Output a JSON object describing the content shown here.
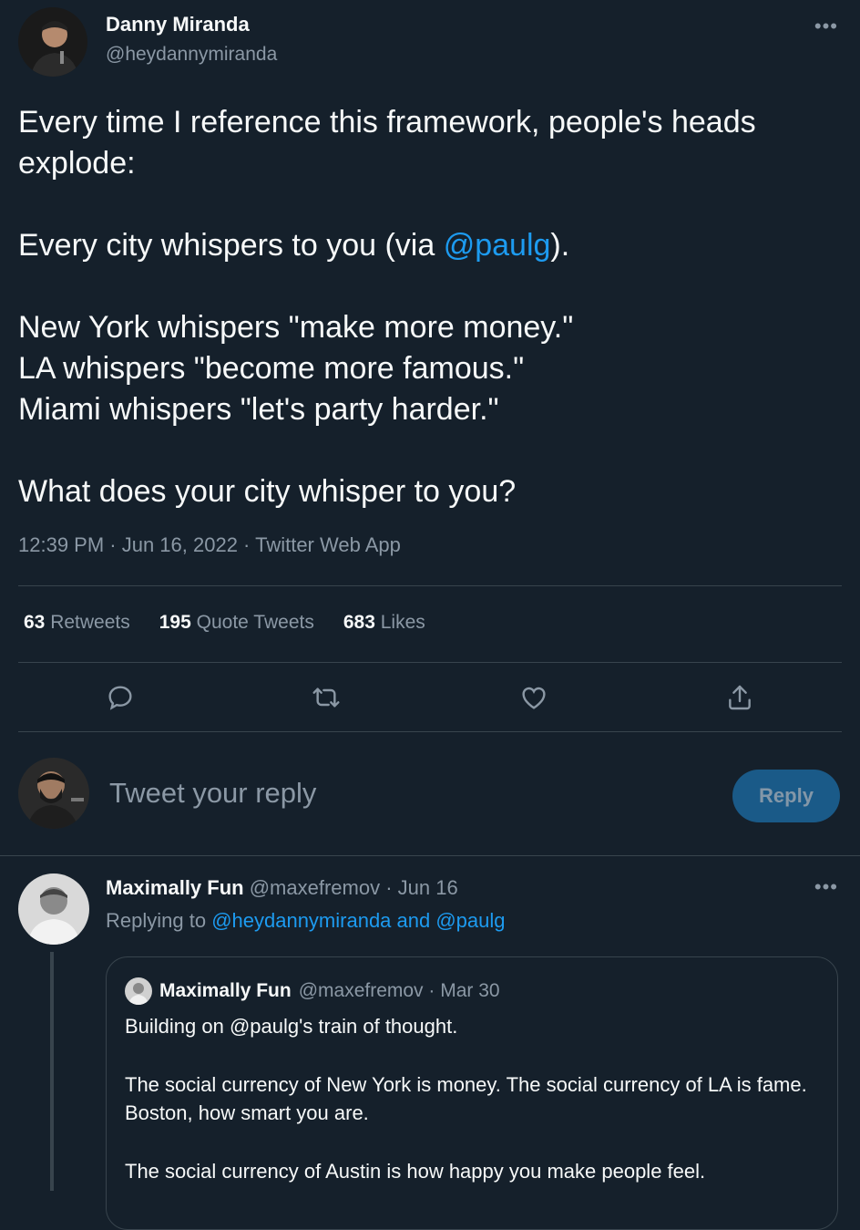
{
  "tweet": {
    "author_name": "Danny Miranda",
    "author_handle": "@heydannymiranda",
    "more_icon": "•••",
    "body": {
      "line1": "Every time I reference this framework, people's heads explode:",
      "line2_prefix": "Every city whispers to you (via ",
      "line2_mention": "@paulg",
      "line2_suffix": ").",
      "line3": "New York whispers \"make more money.\"",
      "line4": "LA whispers \"become more famous.\"",
      "line5": "Miami whispers \"let's party harder.\"",
      "line6": "What does your city whisper to you?"
    },
    "meta": "12:39 PM · Jun 16, 2022 · Twitter Web App",
    "stats": {
      "retweets_count": "63",
      "retweets_label": "Retweets",
      "quotes_count": "195",
      "quotes_label": "Quote Tweets",
      "likes_count": "683",
      "likes_label": "Likes"
    },
    "actions": [
      "reply-icon",
      "retweet-icon",
      "like-icon",
      "share-icon"
    ]
  },
  "composer": {
    "placeholder": "Tweet your reply",
    "reply_button": "Reply"
  },
  "reply": {
    "name": "Maximally Fun",
    "handle_date": "@maxefremov · Jun 16",
    "replying_prefix": "Replying to ",
    "replying_targets": "@heydannymiranda and @paulg",
    "more_icon": "•••",
    "quote": {
      "name": "Maximally Fun",
      "handle_date": "@maxefremov · Mar 30",
      "line1": "Building on @paulg's train of thought.",
      "line2": "The social currency of New York is money. The social currency of LA is fame. Boston, how smart you are.",
      "line3": "The social currency of Austin is how happy you make people feel."
    }
  },
  "colors": {
    "background": "#15202b",
    "link": "#1d9bf0",
    "muted": "#8b98a5",
    "divider": "#38444d"
  }
}
